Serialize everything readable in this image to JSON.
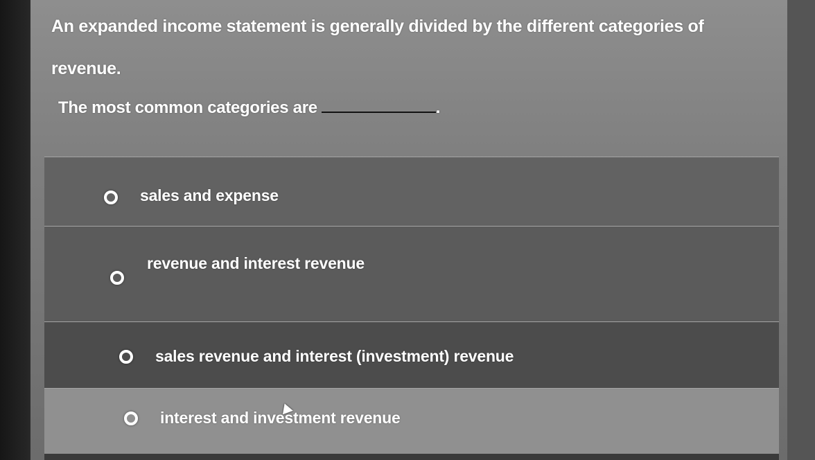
{
  "question": {
    "text": "An expanded income statement is generally divided by the different categories of revenue."
  },
  "prompt": {
    "text": "The most common categories are",
    "suffix": "."
  },
  "options": [
    {
      "label": "sales and expense",
      "selected": false
    },
    {
      "label": "revenue and interest revenue",
      "selected": false
    },
    {
      "label": "sales revenue and interest (investment) revenue",
      "selected": false
    },
    {
      "label": "interest and investment revenue",
      "selected": false
    }
  ],
  "colors": {
    "text": "#ffffff",
    "panel": "#7f7f7f",
    "option_hover": "#909090"
  },
  "icons": {
    "radio": "radio-unselected-icon",
    "cursor": "mouse-pointer-icon"
  }
}
